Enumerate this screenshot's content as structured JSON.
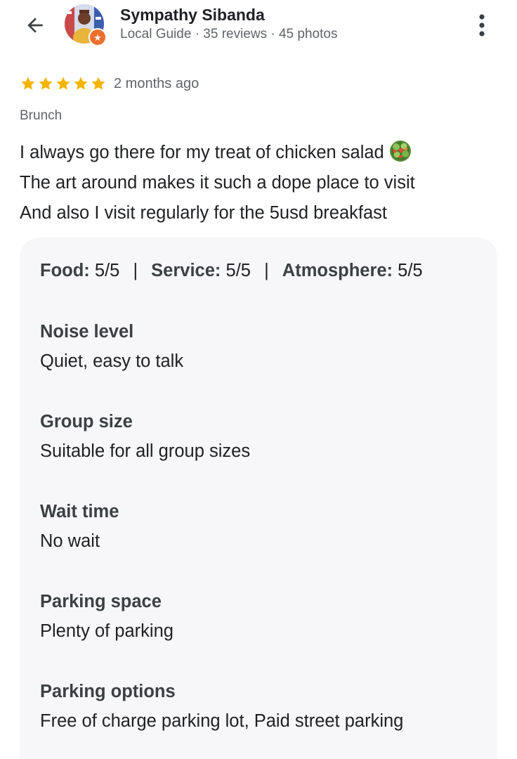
{
  "header": {
    "reviewer_name": "Sympathy Sibanda",
    "reviewer_meta": "Local Guide · 35 reviews · 45 photos"
  },
  "review": {
    "rating": 5,
    "rating_max": 5,
    "date": "2 months ago",
    "meal_type": "Brunch",
    "lines": [
      "I always go there for my treat of chicken salad",
      "The art around makes it such a dope place to visit",
      "And also I visit regularly for the 5usd breakfast"
    ],
    "emoji": "green-salad-icon"
  },
  "scores": [
    {
      "label": "Food:",
      "value": "5/5"
    },
    {
      "label": "Service:",
      "value": "5/5"
    },
    {
      "label": "Atmosphere:",
      "value": "5/5"
    }
  ],
  "score_separator": "|",
  "attributes": [
    {
      "title": "Noise level",
      "value": "Quiet, easy to talk"
    },
    {
      "title": "Group size",
      "value": "Suitable for all group sizes"
    },
    {
      "title": "Wait time",
      "value": "No wait"
    },
    {
      "title": "Parking space",
      "value": "Plenty of parking"
    },
    {
      "title": "Parking options",
      "value": "Free of charge parking lot, Paid street parking"
    }
  ],
  "colors": {
    "star": "#f4b400",
    "badge": "#ee6e2c",
    "card_bg": "#f7f7f9"
  }
}
